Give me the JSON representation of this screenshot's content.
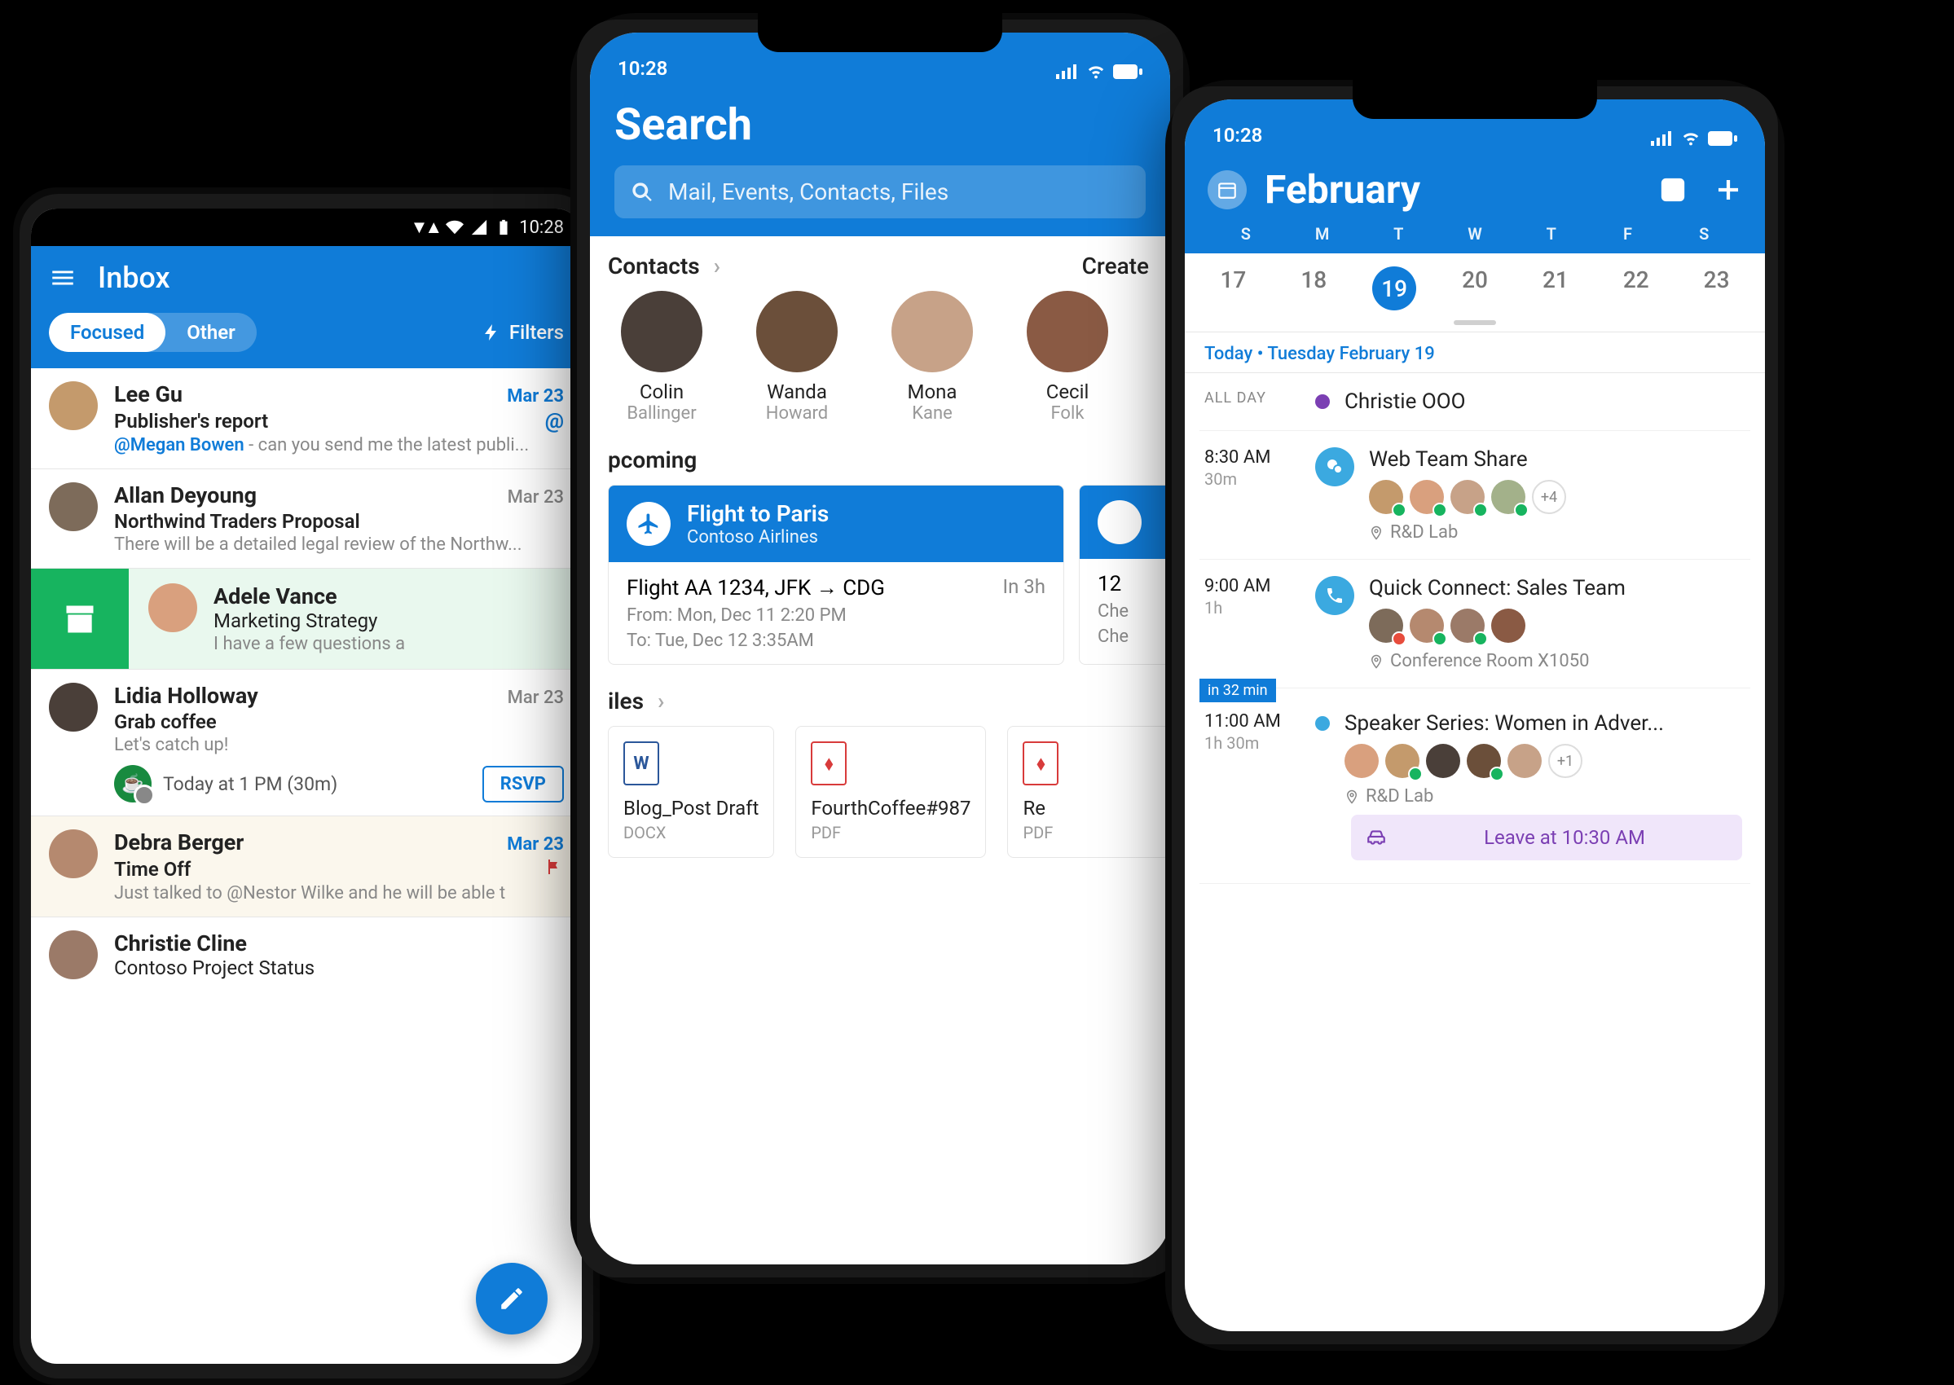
{
  "android": {
    "status_time": "10:28",
    "title": "Inbox",
    "seg_focused": "Focused",
    "seg_other": "Other",
    "filters": "Filters",
    "emails": [
      {
        "sender": "Lee Gu",
        "date": "Mar 23",
        "dateBlue": true,
        "subject": "Publisher's report",
        "mention": "@Megan Bowen",
        "preview": " - can you send me the latest publi...",
        "hasAt": true
      },
      {
        "sender": "Allan Deyoung",
        "date": "Mar 23",
        "subject": "Northwind Traders Proposal",
        "preview": "There will be a detailed legal review of the Northw..."
      },
      {
        "swipe": true,
        "sender": "Adele Vance",
        "subject": "Marketing Strategy",
        "preview": "I have a few questions a"
      },
      {
        "sender": "Lidia Holloway",
        "date": "Mar 23",
        "subject": "Grab coffee",
        "preview": "Let's catch up!",
        "event": "Today at 1 PM (30m)",
        "rsvp": "RSVP"
      },
      {
        "alt": true,
        "sender": "Debra Berger",
        "date": "Mar 23",
        "dateBlue": true,
        "subject": "Time Off",
        "preview": "Just talked to @Nestor Wilke and he will be able t",
        "flag": true
      },
      {
        "sender": "Christie Cline",
        "subject": "Contoso Project Status"
      }
    ]
  },
  "center": {
    "status_time": "10:28",
    "title": "Search",
    "placeholder": "Mail, Events, Contacts, Files",
    "contacts_h": "Contacts",
    "create": "Create",
    "contacts": [
      {
        "first": "Colin",
        "last": "Ballinger"
      },
      {
        "first": "Wanda",
        "last": "Howard"
      },
      {
        "first": "Mona",
        "last": "Kane"
      },
      {
        "first": "Cecil",
        "last": "Folk"
      }
    ],
    "upcoming_h": "pcoming",
    "card": {
      "title": "Flight to Paris",
      "sub": "Contoso Airlines",
      "line": "Flight AA 1234, JFK → CDG",
      "in": "In 3h",
      "from": "From: Mon, Dec 11 2:20 PM",
      "to": "To: Tue, Dec 12 3:35AM"
    },
    "card2": {
      "line": "12",
      "from": "Che",
      "to": "Che"
    },
    "files_h": "iles",
    "files": [
      {
        "name": "Blog_Post Draft",
        "type": "DOCX",
        "kind": "w",
        "glyph": "W"
      },
      {
        "name": "FourthCoffee#987",
        "type": "PDF",
        "kind": "p",
        "glyph": "⬧"
      },
      {
        "name": "Re",
        "type": "PDF",
        "kind": "p",
        "glyph": "⬧"
      }
    ]
  },
  "cal": {
    "status_time": "10:28",
    "month": "February",
    "dow": [
      "S",
      "M",
      "T",
      "W",
      "T",
      "F",
      "S"
    ],
    "dates": [
      "17",
      "18",
      "19",
      "20",
      "21",
      "22",
      "23"
    ],
    "sel": 2,
    "today": "Today • Tuesday February 19",
    "allday_label": "ALL DAY",
    "allday_title": "Christie OOO",
    "events": [
      {
        "time": "8:30 AM",
        "dur": "30m",
        "title": "Web Team Share",
        "loc": "R&D Lab",
        "ico": "chat",
        "more": "+4",
        "atts": [
          "ok",
          "ok",
          "ok",
          "ok"
        ]
      },
      {
        "time": "9:00 AM",
        "dur": "1h",
        "title": "Quick Connect: Sales Team",
        "loc": "Conference Room X1050",
        "ico": "phone",
        "atts": [
          "no",
          "ok",
          "ok",
          ""
        ]
      },
      {
        "soon": "in 32 min",
        "time": "11:00 AM",
        "dur": "1h 30m",
        "title": "Speaker Series: Women in Adver...",
        "loc": "R&D Lab",
        "ico": "dot",
        "more": "+1",
        "atts": [
          "",
          "ok",
          "",
          "ok",
          ""
        ]
      }
    ],
    "leave": "Leave at 10:30 AM"
  }
}
